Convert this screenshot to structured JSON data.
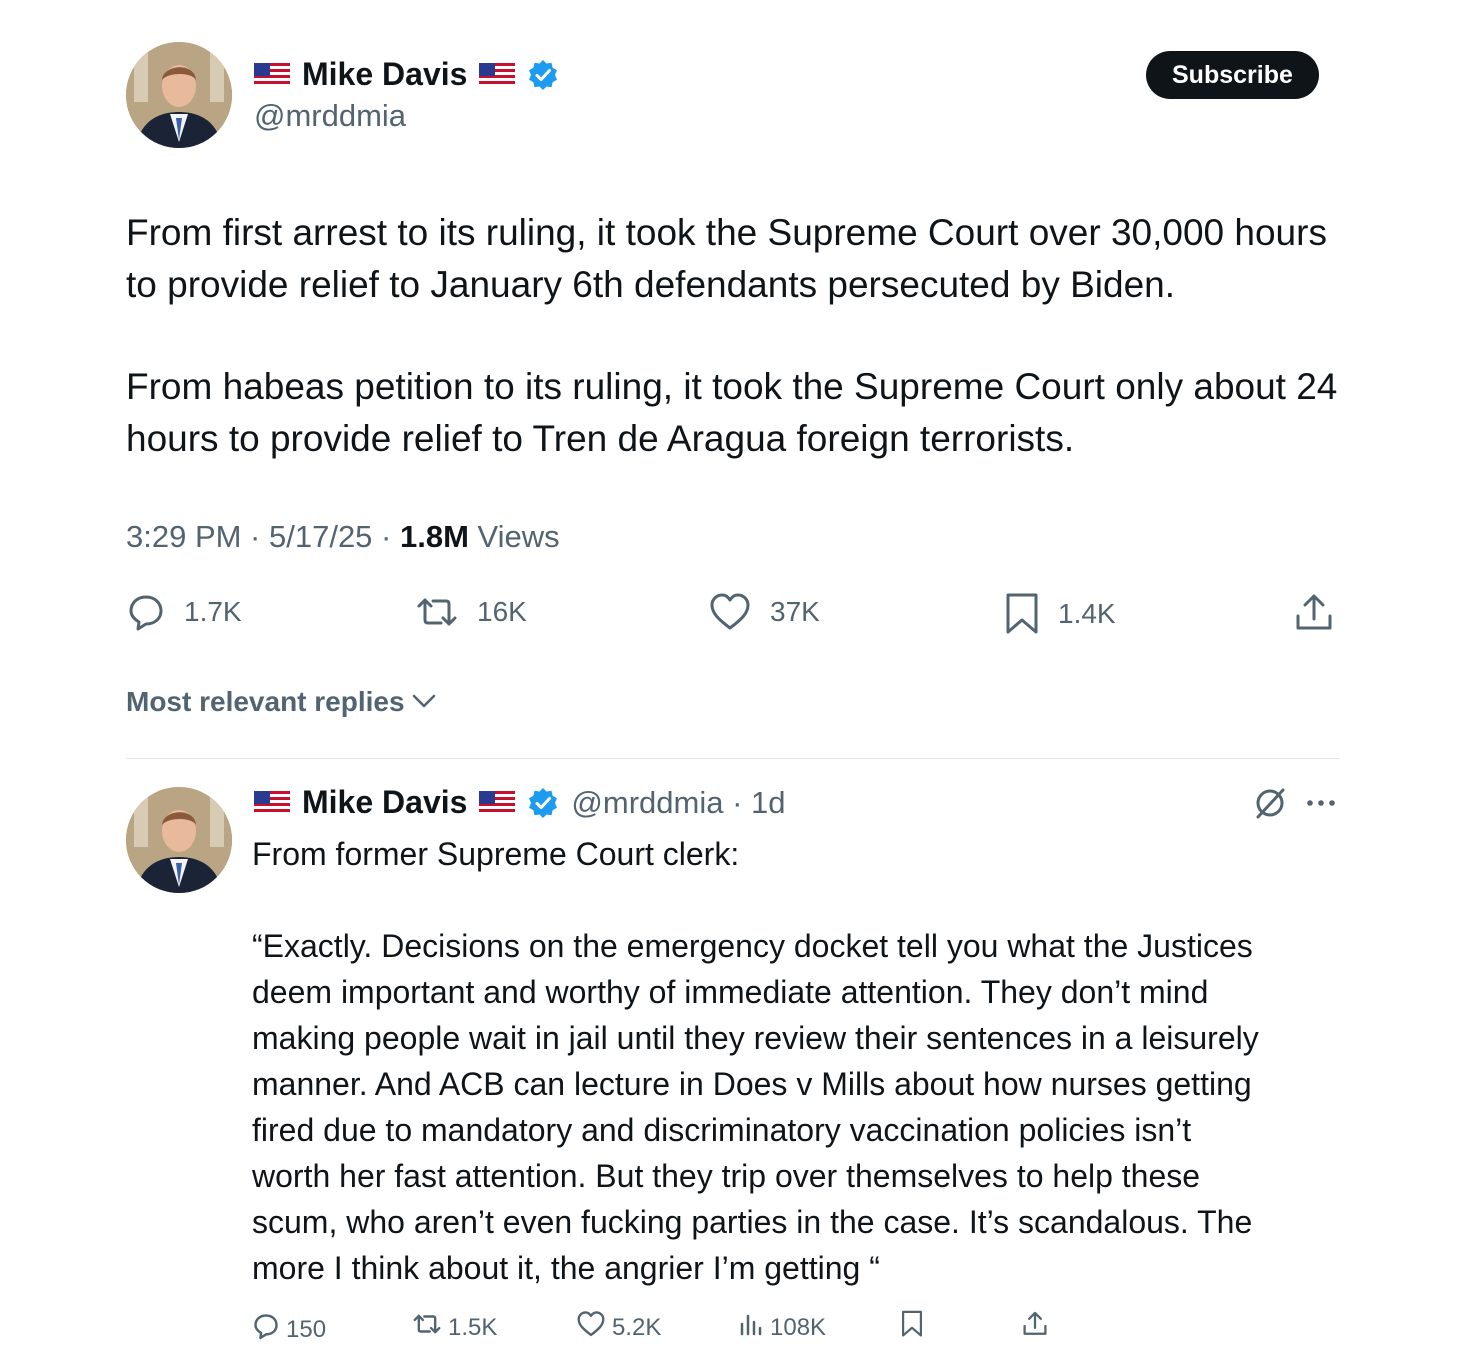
{
  "tweet": {
    "author_name": "Mike Davis",
    "author_handle": "@mrddmia",
    "subscribe_label": "Subscribe",
    "paragraph_1": "From first arrest to its ruling, it took the Supreme Court over 30,000 hours to provide relief to January 6th defendants persecuted by Biden.",
    "paragraph_2": "From habeas petition to its ruling, it took the Supreme Court only about 24 hours to provide relief to Tren de Aragua foreign terrorists.",
    "time": "3:29 PM · 5/17/25 · ",
    "views_count": "1.8M",
    "views_label": " Views",
    "actions": {
      "replies": "1.7K",
      "reposts": "16K",
      "likes": "37K",
      "bookmarks": "1.4K"
    }
  },
  "replies_sort": {
    "label": "Most relevant replies"
  },
  "reply": {
    "author_name": "Mike Davis",
    "meta": "@mrddmia · 1d",
    "line_1": "From former Supreme Court clerk:",
    "quote_lines": [
      "“Exactly. Decisions on the emergency docket tell you what the Justices",
      "deem important and worthy of immediate attention. They don’t mind",
      "making people wait in jail until they review their sentences in a leisurely",
      "manner. And ACB can lecture in Does v Mills about how nurses getting",
      "fired due to mandatory and discriminatory vaccination policies isn’t",
      "worth her fast attention. But they trip over themselves to help these",
      "scum, who aren’t even fucking parties in the case. It’s scandalous. The",
      "more I think about it, the angrier I’m getting “"
    ],
    "actions": {
      "replies": "150",
      "reposts": "1.5K",
      "likes": "5.2K",
      "views": "108K"
    }
  },
  "colors": {
    "text": "#0f1419",
    "muted": "#536471",
    "verified": "#1d9bf0"
  },
  "icons": [
    "flag-icon",
    "verified-badge-icon",
    "reply-icon",
    "repost-icon",
    "like-icon",
    "bookmark-icon",
    "share-icon",
    "chevron-down-icon",
    "grok-icon",
    "more-icon",
    "views-icon"
  ]
}
